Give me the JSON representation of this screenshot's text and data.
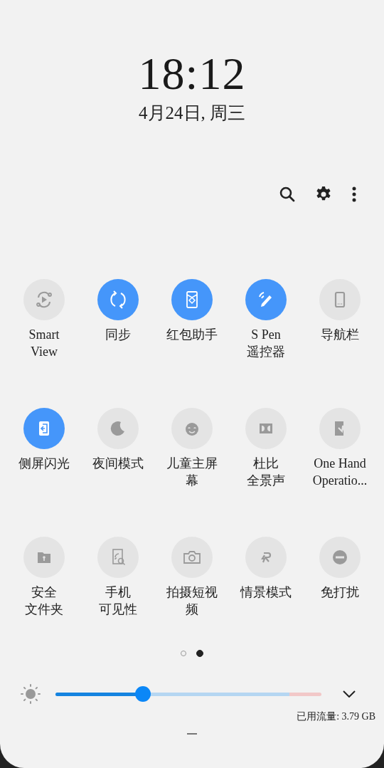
{
  "clock": {
    "time": "18:12",
    "date": "4月24日, 周三"
  },
  "tiles": [
    {
      "label": "Smart View",
      "on": false
    },
    {
      "label": "同步",
      "on": true
    },
    {
      "label": "红包助手",
      "on": true
    },
    {
      "lines": [
        "S Pen",
        "遥控器"
      ],
      "on": true
    },
    {
      "label": "导航栏",
      "on": false
    },
    {
      "label": "侧屏闪光",
      "on": true
    },
    {
      "label": "夜间模式",
      "on": false
    },
    {
      "label": "儿童主屏幕",
      "on": false
    },
    {
      "lines": [
        "杜比",
        "全景声"
      ],
      "on": false
    },
    {
      "lines": [
        "One Hand",
        "Operatio..."
      ],
      "on": false
    },
    {
      "lines": [
        "安全",
        "文件夹"
      ],
      "on": false
    },
    {
      "lines": [
        "手机",
        "可见性"
      ],
      "on": false
    },
    {
      "label": "拍摄短视频",
      "on": false
    },
    {
      "label": "情景模式",
      "on": false
    },
    {
      "label": "免打扰",
      "on": false
    }
  ],
  "pages": [
    {
      "selected": false
    },
    {
      "selected": true
    }
  ],
  "brightness": {
    "level": 0.33
  },
  "data_usage": "已用流量: 3.79 GB"
}
